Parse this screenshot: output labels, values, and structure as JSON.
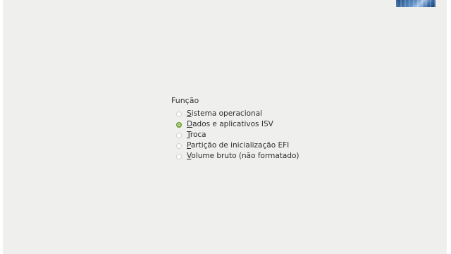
{
  "window": {
    "accent_color": "#6c9b2b",
    "background_color": "#efefee"
  },
  "role_group": {
    "label": "Função",
    "selected_index": 1,
    "options": [
      {
        "mnemonic": "S",
        "rest": "istema operacional",
        "checked": false
      },
      {
        "mnemonic": "D",
        "rest": "ados e aplicativos ISV",
        "checked": true
      },
      {
        "mnemonic": "T",
        "rest": "roca",
        "checked": false
      },
      {
        "mnemonic": "P",
        "rest": "artição de inicialização EFI",
        "checked": false
      },
      {
        "mnemonic": "V",
        "rest": "olume bruto (não formatado)",
        "checked": false
      }
    ]
  },
  "corner_thumbnail": {
    "icon": "background-thumbnail-icon"
  }
}
